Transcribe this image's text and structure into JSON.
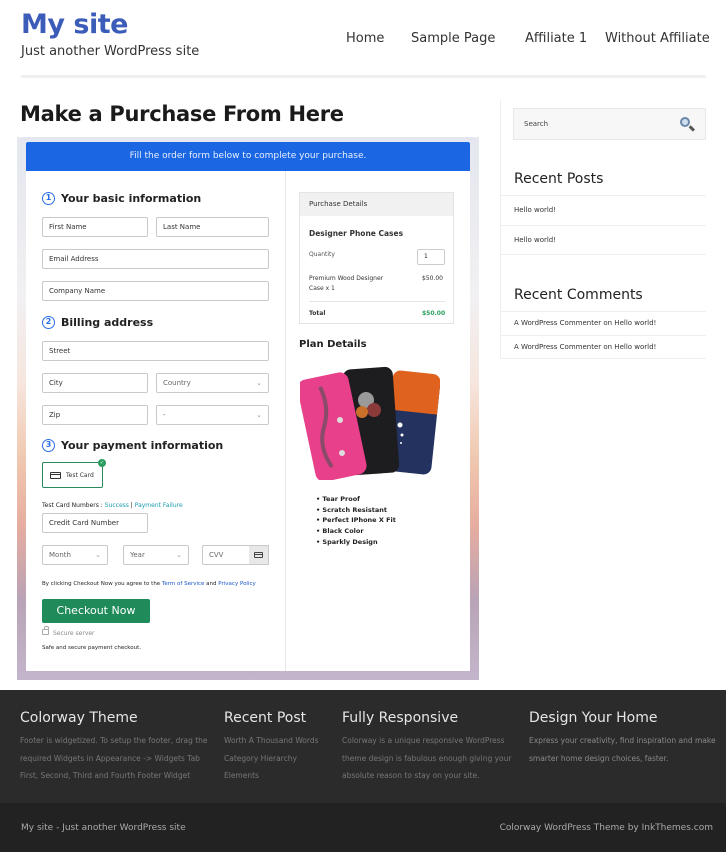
{
  "header": {
    "site_title": "My site",
    "tagline": "Just another WordPress site",
    "nav": [
      "Home",
      "Sample Page",
      "Affiliate 1",
      "Without Affiliate"
    ]
  },
  "page": {
    "title": "Make a Purchase From Here"
  },
  "form": {
    "banner": "Fill the order form below to complete your purchase.",
    "step1": {
      "num": "1",
      "label": "Your basic information"
    },
    "step2": {
      "num": "2",
      "label": "Billing address"
    },
    "step3": {
      "num": "3",
      "label": "Your payment information"
    },
    "fields": {
      "first_name": "First Name",
      "last_name": "Last Name",
      "email": "Email Address",
      "company": "Company Name",
      "street": "Street",
      "city": "City",
      "country": "Country",
      "zip": "Zip",
      "state": "-",
      "card_number": "Credit Card Number",
      "month": "Month",
      "year": "Year",
      "cvv": "CVV"
    },
    "test_card_label": "Test Card",
    "test_numbers_prefix": "Test Card Numbers : ",
    "test_success": "Success",
    "test_sep": " | ",
    "test_failure": "Payment Failure",
    "agree_prefix": "By clicking Checkout Now you agree to the ",
    "terms": "Term of Service",
    "agree_and": " and ",
    "privacy": "Privacy Policy",
    "checkout_label": "Checkout Now",
    "secure_server": "Secure server",
    "safe_text": "Safe and secure payment checkout."
  },
  "purchase": {
    "header": "Purchase Details",
    "product": "Designer Phone Cases",
    "quantity_label": "Quantity",
    "quantity_value": "1",
    "item_line1": "Premium Wood Designer",
    "item_line2": "Case x 1",
    "item_price": "$50.00",
    "total_label": "Total",
    "total_value": "$50.00"
  },
  "plan": {
    "title": "Plan Details",
    "features": [
      "Tear Proof",
      "Scratch Resistant",
      "Perfect IPhone X Fit",
      "Black Color",
      "Sparkly Design"
    ]
  },
  "sidebar": {
    "search_placeholder": "Search",
    "recent_posts_title": "Recent Posts",
    "recent_posts": [
      "Hello world!",
      "Hello world!"
    ],
    "recent_comments_title": "Recent Comments",
    "recent_comments": [
      "A WordPress Commenter on Hello world!",
      "A WordPress Commenter on Hello world!"
    ]
  },
  "footer": {
    "col1_title": "Colorway Theme",
    "col1_lines": [
      "Footer is widgetized. To setup the footer, drag the",
      "required Widgets in Appearance -> Widgets Tab",
      "First, Second, Third and Fourth Footer Widget"
    ],
    "col2_title": "Recent Post",
    "col2_lines": [
      "Worth A Thousand Words",
      "Category Hierarchy",
      "Elements"
    ],
    "col3_title": "Fully Responsive",
    "col3_lines": [
      "Colorway is a unique responsive WordPress",
      "theme design is fabulous enough giving your",
      "absolute reason to stay on your site."
    ],
    "col4_title": "Design Your Home",
    "col4_lines": [
      "Express your creativity, find inspiration and make",
      "smarter home design choices, faster."
    ],
    "bottom_left": "My site - Just another WordPress site",
    "bottom_right": "Colorway WordPress Theme by InkThemes.com"
  },
  "colors": {
    "brand_blue": "#3b5cb8",
    "banner_blue": "#1b67e3",
    "checkout_green": "#1f8b5a",
    "total_green": "#2aa05e"
  }
}
